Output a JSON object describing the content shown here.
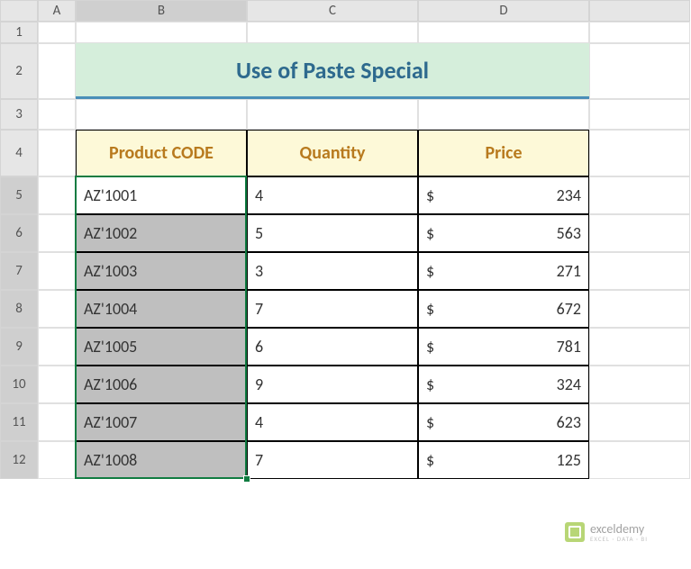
{
  "columns": [
    "A",
    "B",
    "C",
    "D"
  ],
  "rows": [
    "1",
    "2",
    "3",
    "4",
    "5",
    "6",
    "7",
    "8",
    "9",
    "10",
    "11",
    "12"
  ],
  "title": "Use of Paste Special",
  "headers": {
    "b": "Product CODE",
    "c": "Quantity",
    "d": "Price"
  },
  "data": [
    {
      "code": "AZ'1001",
      "qty": "4",
      "cur": "$",
      "price": "234"
    },
    {
      "code": "AZ'1002",
      "qty": "5",
      "cur": "$",
      "price": "563"
    },
    {
      "code": "AZ'1003",
      "qty": "3",
      "cur": "$",
      "price": "271"
    },
    {
      "code": "AZ'1004",
      "qty": "7",
      "cur": "$",
      "price": "672"
    },
    {
      "code": "AZ'1005",
      "qty": "6",
      "cur": "$",
      "price": "781"
    },
    {
      "code": "AZ'1006",
      "qty": "9",
      "cur": "$",
      "price": "324"
    },
    {
      "code": "AZ'1007",
      "qty": "4",
      "cur": "$",
      "price": "623"
    },
    {
      "code": "AZ'1008",
      "qty": "7",
      "cur": "$",
      "price": "125"
    }
  ],
  "watermark": {
    "name": "exceldemy",
    "tag": "EXCEL · DATA · BI"
  }
}
